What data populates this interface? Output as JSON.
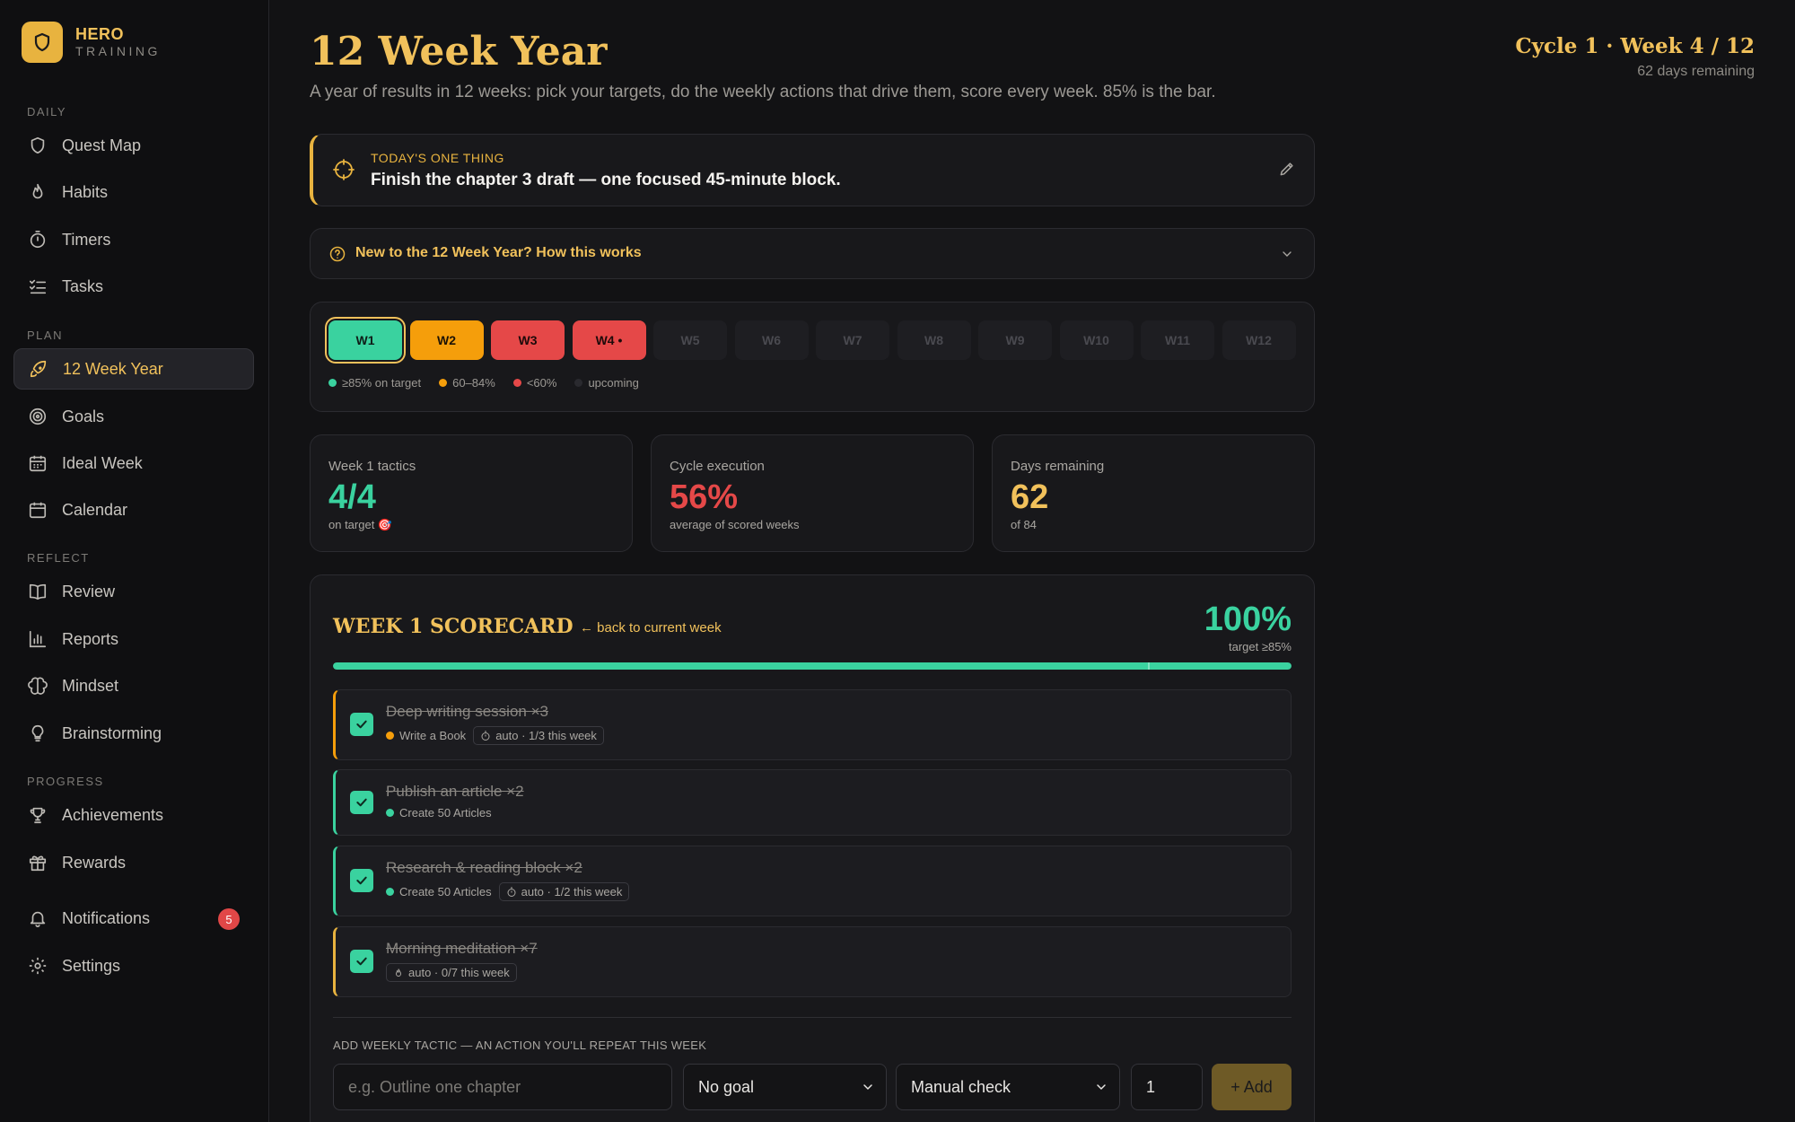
{
  "brand": {
    "name": "HERO",
    "sub": "TRAINING"
  },
  "sidebar": {
    "sections": {
      "daily": "DAILY",
      "plan": "PLAN",
      "reflect": "REFLECT",
      "progress": "PROGRESS"
    },
    "items": {
      "quest_map": "Quest Map",
      "habits": "Habits",
      "timers": "Timers",
      "tasks": "Tasks",
      "twelve_week_year": "12 Week Year",
      "goals": "Goals",
      "ideal_week": "Ideal Week",
      "calendar": "Calendar",
      "review": "Review",
      "reports": "Reports",
      "mindset": "Mindset",
      "brainstorming": "Brainstorming",
      "achievements": "Achievements",
      "rewards": "Rewards",
      "notifications": "Notifications",
      "settings": "Settings"
    },
    "notifications_count": "5",
    "active": "twelve_week_year"
  },
  "header": {
    "title": "12 Week Year",
    "subtitle": "A year of results in 12 weeks: pick your targets, do the weekly actions that drive them, score every week. 85% is the bar.",
    "cycle_label": "Cycle 1 · Week 4 / 12",
    "days_remaining_text": "62 days remaining"
  },
  "one_thing": {
    "label": "TODAY'S ONE THING",
    "text": "Finish the chapter 3 draft — one focused 45-minute block."
  },
  "how_it_works": {
    "label": "New to the 12 Week Year? How this works"
  },
  "weeks": [
    {
      "label": "W1",
      "status": "green",
      "selected": true
    },
    {
      "label": "W2",
      "status": "orange"
    },
    {
      "label": "W3",
      "status": "red"
    },
    {
      "label": "W4 •",
      "status": "red"
    },
    {
      "label": "W5",
      "status": "upcoming"
    },
    {
      "label": "W6",
      "status": "upcoming"
    },
    {
      "label": "W7",
      "status": "upcoming"
    },
    {
      "label": "W8",
      "status": "upcoming"
    },
    {
      "label": "W9",
      "status": "upcoming"
    },
    {
      "label": "W10",
      "status": "upcoming"
    },
    {
      "label": "W11",
      "status": "upcoming"
    },
    {
      "label": "W12",
      "status": "upcoming"
    }
  ],
  "legend": {
    "green": "≥85% on target",
    "orange": "60–84%",
    "red": "<60%",
    "upcoming": "upcoming"
  },
  "colors": {
    "green": "#3ad29f",
    "orange": "#f59e0b",
    "red": "#e54848",
    "accent": "#f1c15b",
    "upcoming": "#1e1e22"
  },
  "stats": {
    "tactics": {
      "label": "Week 1 tactics",
      "value": "4/4",
      "sub": "on target 🎯"
    },
    "execution": {
      "label": "Cycle execution",
      "value": "56%",
      "sub": "average of scored weeks"
    },
    "days": {
      "label": "Days remaining",
      "value": "62",
      "sub": "of 84"
    }
  },
  "scorecard": {
    "title": "WEEK 1 SCORECARD",
    "back_link": "← back to current week",
    "percent": "100%",
    "target": "target ≥85%",
    "progress": 1.0,
    "target_marker": 0.85,
    "tactics": [
      {
        "name": "Deep writing session ×3",
        "goal": "Write a Book",
        "goal_color": "#f59e0b",
        "auto": "auto · 1/3 this week",
        "done": true
      },
      {
        "name": "Publish an article ×2",
        "goal": "Create 50 Articles",
        "goal_color": "#3ad29f",
        "auto": "",
        "done": true
      },
      {
        "name": "Research & reading block ×2",
        "goal": "Create 50 Articles",
        "goal_color": "#3ad29f",
        "auto": "auto · 1/2 this week",
        "done": true
      },
      {
        "name": "Morning meditation ×7",
        "goal": "",
        "goal_color": "",
        "auto": "auto · 0/7 this week",
        "done": true
      }
    ],
    "add": {
      "label": "ADD WEEKLY TACTIC — AN ACTION YOU'LL REPEAT THIS WEEK",
      "placeholder": "e.g. Outline one chapter",
      "goal_select": "No goal",
      "mode_select": "Manual check",
      "count": "1",
      "button": "+ Add"
    }
  }
}
